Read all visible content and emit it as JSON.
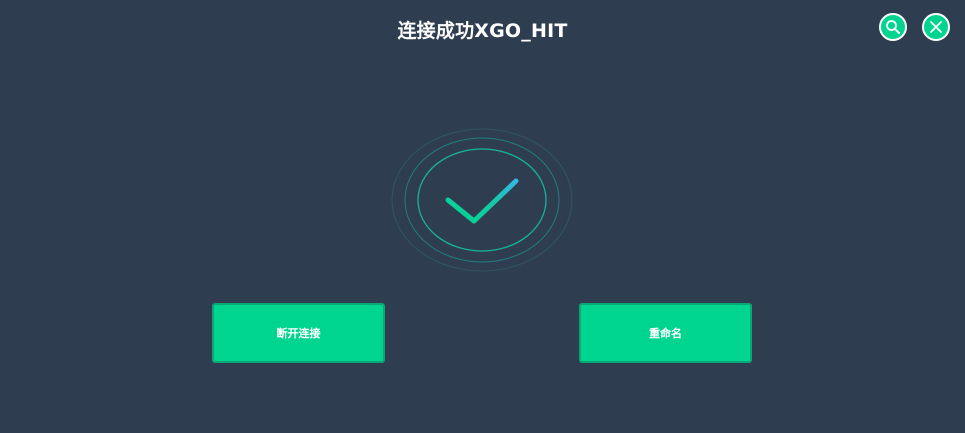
{
  "header": {
    "title": "连接成功XGO_HIT",
    "search_icon": "search-icon",
    "close_icon": "close-icon"
  },
  "status": {
    "icon": "checkmark-icon"
  },
  "actions": {
    "disconnect_label": "断开连接",
    "rename_label": "重命名"
  },
  "colors": {
    "background": "#2e3d4f",
    "accent": "#00d48e",
    "text": "#ffffff"
  }
}
